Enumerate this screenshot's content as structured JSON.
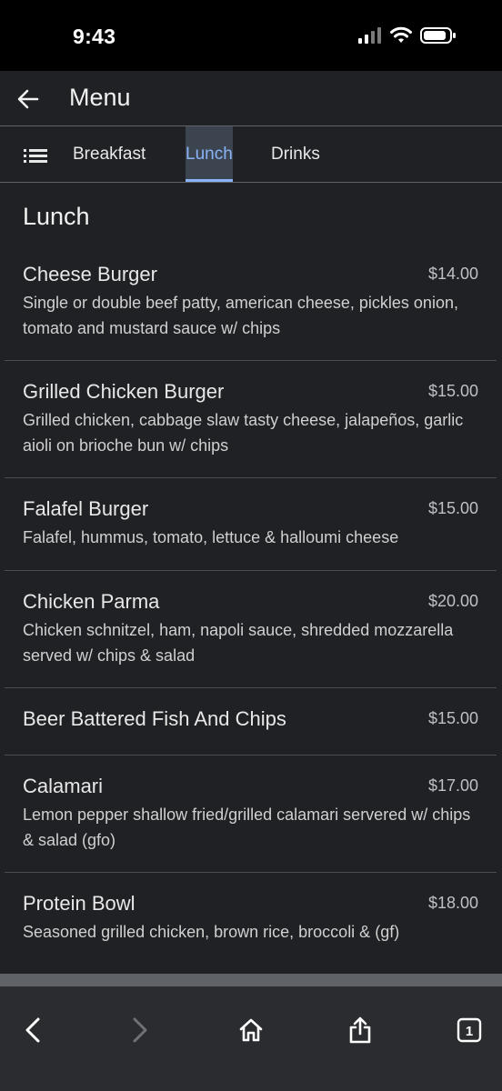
{
  "status_bar": {
    "time": "9:43"
  },
  "header": {
    "title": "Menu"
  },
  "tabs": [
    {
      "label": "Breakfast",
      "active": false
    },
    {
      "label": "Lunch",
      "active": true
    },
    {
      "label": "Drinks",
      "active": false
    }
  ],
  "section": {
    "title": "Lunch"
  },
  "items": [
    {
      "name": "Cheese Burger",
      "price": "$14.00",
      "description": "Single or double beef patty, american cheese, pickles onion, tomato and mustard sauce w/ chips"
    },
    {
      "name": "Grilled Chicken Burger",
      "price": "$15.00",
      "description": "Grilled chicken, cabbage slaw tasty cheese, jalapeños, garlic aioli on brioche bun w/ chips"
    },
    {
      "name": "Falafel Burger",
      "price": "$15.00",
      "description": "Falafel, hummus, tomato, lettuce & halloumi cheese"
    },
    {
      "name": "Chicken Parma",
      "price": "$20.00",
      "description": "Chicken schnitzel, ham, napoli sauce, shredded mozzarella served w/ chips & salad"
    },
    {
      "name": "Beer Battered Fish And Chips",
      "price": "$15.00",
      "description": ""
    },
    {
      "name": "Calamari",
      "price": "$17.00",
      "description": "Lemon pepper shallow fried/grilled calamari servered w/ chips & salad (gfo)"
    },
    {
      "name": "Protein Bowl",
      "price": "$18.00",
      "description": "Seasoned grilled chicken, brown rice, broccoli & (gf)"
    }
  ],
  "toolbar": {
    "tab_count": "1"
  },
  "icons": {
    "back": "arrow-left-icon",
    "list": "list-icon",
    "browser_back": "chevron-left-icon",
    "browser_forward": "chevron-right-icon",
    "home": "home-icon",
    "share": "share-icon",
    "tabs": "tabs-icon"
  },
  "colors": {
    "accent": "#8ab4f8",
    "surface": "#202124",
    "toolbar": "#2b2c2f"
  }
}
